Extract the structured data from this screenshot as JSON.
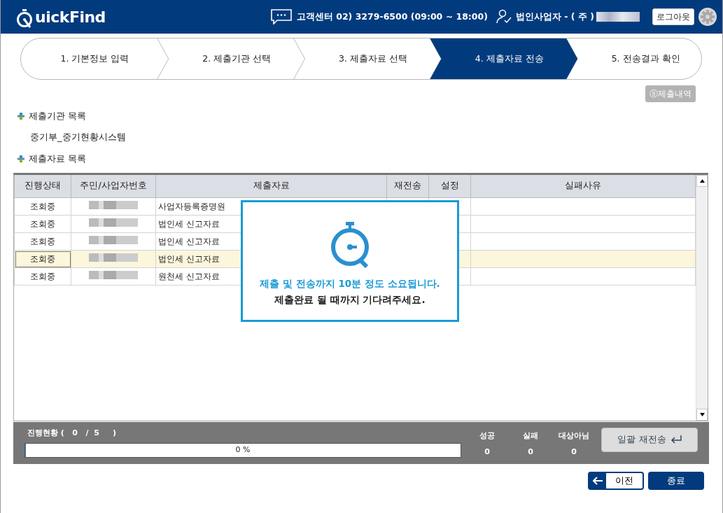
{
  "header": {
    "logo_text": "uickFind",
    "support": "고객센터 02) 3279-6500 (09:00 ~ 18:00)",
    "user": "법인사업자 - ( 주 )",
    "logout": "로그아웃"
  },
  "steps": [
    {
      "label": "1. 기본정보 입력",
      "selected": false
    },
    {
      "label": "2. 제출기관 선택",
      "selected": false
    },
    {
      "label": "3. 제출자료 선택",
      "selected": false
    },
    {
      "label": "4. 제출자료 전송",
      "selected": true
    },
    {
      "label": "5. 전송결과 확인",
      "selected": false
    }
  ],
  "history_button": "ⓢ제출내역",
  "institutions": {
    "title": "제출기관 목록",
    "items": [
      "중기부_중기현황시스템"
    ]
  },
  "documents": {
    "title": "제출자료 목록"
  },
  "table": {
    "columns": [
      "진행상태",
      "주민/사업자번호",
      "제출자료",
      "재전송",
      "설정",
      "실패사유"
    ],
    "rows": [
      {
        "status": "조회중",
        "document": "사업자등록증명원",
        "selected": false
      },
      {
        "status": "조회중",
        "document": "법인세 신고자료",
        "selected": false
      },
      {
        "status": "조회중",
        "document": "법인세 신고자료",
        "selected": false
      },
      {
        "status": "조회중",
        "document": "법인세 신고자료",
        "selected": true
      },
      {
        "status": "조회중",
        "document": "원천세 신고자료",
        "selected": false
      }
    ]
  },
  "modal": {
    "line1": "제출 및 전송까지 10분 정도 소요됩니다.",
    "line2": "제출완료 될 때까지 기다려주세요."
  },
  "progress": {
    "label": "진행현황 (   0   /  5     )",
    "level": 0,
    "reading": "0 %",
    "stats": [
      {
        "label": "성공",
        "value": "0"
      },
      {
        "label": "실패",
        "value": "0"
      },
      {
        "label": "대상아님",
        "value": "0"
      }
    ],
    "resend_button": "일괄 재전송"
  },
  "footer": {
    "prev_button": "이전",
    "close_button": "종료"
  }
}
